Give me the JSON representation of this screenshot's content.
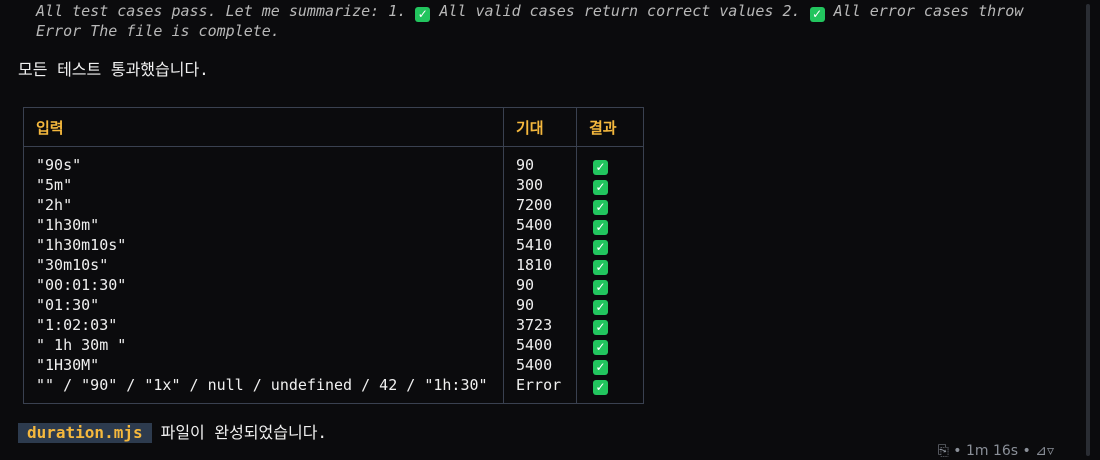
{
  "thinking_text_1": "All test cases pass. Let me summarize: 1. ",
  "thinking_text_2": " All valid cases return correct values 2. ",
  "thinking_text_3": " All error cases throw Error The file is complete.",
  "summary": "모든 테스트 통과했습니다.",
  "check_mark": "✓",
  "table": {
    "headers": {
      "input": "입력",
      "expected": "기대",
      "result": "결과"
    },
    "rows": [
      {
        "input": "\"90s\"",
        "expected": "90"
      },
      {
        "input": "\"5m\"",
        "expected": "300"
      },
      {
        "input": "\"2h\"",
        "expected": "7200"
      },
      {
        "input": "\"1h30m\"",
        "expected": "5400"
      },
      {
        "input": "\"1h30m10s\"",
        "expected": "5410"
      },
      {
        "input": "\"30m10s\"",
        "expected": "1810"
      },
      {
        "input": "\"00:01:30\"",
        "expected": "90"
      },
      {
        "input": "\"01:30\"",
        "expected": "90"
      },
      {
        "input": "\"1:02:03\"",
        "expected": "3723"
      },
      {
        "input": "\" 1h 30m \"",
        "expected": "5400"
      },
      {
        "input": "\"1H30M\"",
        "expected": "5400"
      },
      {
        "input": "\"\" / \"90\" / \"1x\" / null / undefined / 42 / \"1h:30\"",
        "expected": "Error"
      }
    ]
  },
  "footer": {
    "filename": "duration.mjs",
    "message": "파일이 완성되었습니다."
  },
  "status": {
    "elapsed": "1m 16s",
    "separator": "•",
    "toggle_glyph": "⊿▿"
  },
  "colors": {
    "check_green": "#22c55e",
    "header_yellow": "#f5b83d",
    "background": "#0b0b0d",
    "filename_bg": "#2d3b4e"
  },
  "icons": [
    "check-icon",
    "copy-icon",
    "expand-icon"
  ]
}
